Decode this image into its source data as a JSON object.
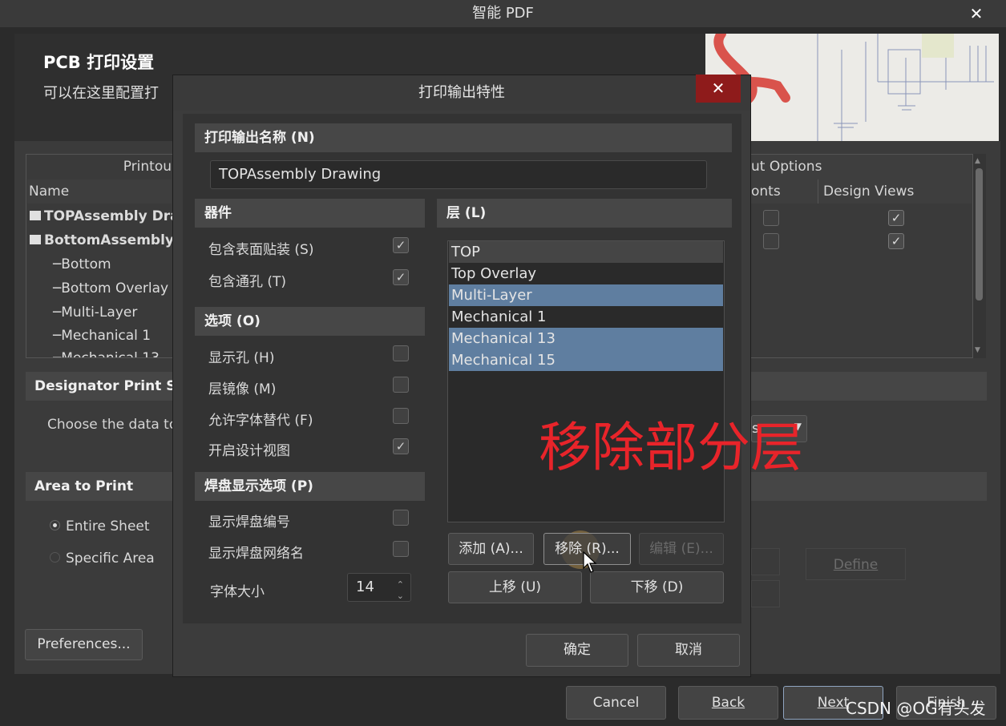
{
  "wizard": {
    "title": "智能 PDF",
    "header_title": "PCB 打印设置",
    "header_subtitle": "可以在这里配置打",
    "printout": {
      "header_left": "Printou",
      "header_right": "ut Options",
      "col_name": "Name",
      "col_fonts": "onts",
      "col_design_views": "Design Views",
      "rows": [
        {
          "label": "TOPAssembly Dra",
          "bold": true,
          "fonts": false,
          "design_views": true
        },
        {
          "label": "BottomAssembly",
          "bold": true,
          "fonts": false,
          "design_views": true
        },
        {
          "label": "Bottom"
        },
        {
          "label": "Bottom Overlay"
        },
        {
          "label": "Multi-Layer"
        },
        {
          "label": "Mechanical 1"
        },
        {
          "label": "Mechanical 13"
        }
      ]
    },
    "designator": {
      "title": "Designator Print Se",
      "text": "Choose the data to",
      "dropdown_value": "s"
    },
    "area": {
      "title": "Area to Print",
      "entire": "Entire Sheet",
      "specific": "Specific Area",
      "define": "Define"
    },
    "preferences": "Preferences...",
    "buttons": {
      "cancel": "Cancel",
      "back": "Back",
      "next": "Next",
      "finish": "Finish"
    }
  },
  "dialog": {
    "title": "打印输出特性",
    "name_section": "打印输出名称 (N)",
    "name_value": "TOPAssembly Drawing",
    "components_section": "器件",
    "components": [
      {
        "label": "包含表面贴装 (S)",
        "checked": true
      },
      {
        "label": "包含通孔 (T)",
        "checked": true
      }
    ],
    "options_section": "选项 (O)",
    "options": [
      {
        "label": "显示孔 (H)",
        "checked": false
      },
      {
        "label": "层镜像 (M)",
        "checked": false
      },
      {
        "label": "允许字体替代 (F)",
        "checked": false
      },
      {
        "label": "开启设计视图",
        "checked": true
      }
    ],
    "pad_section": "焊盘显示选项 (P)",
    "pad_options": [
      {
        "label": "显示焊盘编号",
        "checked": false
      },
      {
        "label": "显示焊盘网络名",
        "checked": false
      }
    ],
    "font_size_label": "字体大小",
    "font_size": "14",
    "layers_section": "层 (L)",
    "layers": [
      {
        "label": "TOP",
        "selected": false
      },
      {
        "label": "Top Overlay",
        "selected": false
      },
      {
        "label": "Multi-Layer",
        "selected": true
      },
      {
        "label": "Mechanical 1",
        "selected": false
      },
      {
        "label": "Mechanical 13",
        "selected": true
      },
      {
        "label": "Mechanical 15",
        "selected": true
      }
    ],
    "btn_add": "添加 (A)...",
    "btn_remove": "移除 (R)...",
    "btn_edit": "编辑 (E)...",
    "btn_up": "上移 (U)",
    "btn_down": "下移 (D)",
    "btn_ok": "确定",
    "btn_cancel": "取消"
  },
  "annotation": "移除部分层",
  "watermark": "CSDN @OG有头发"
}
